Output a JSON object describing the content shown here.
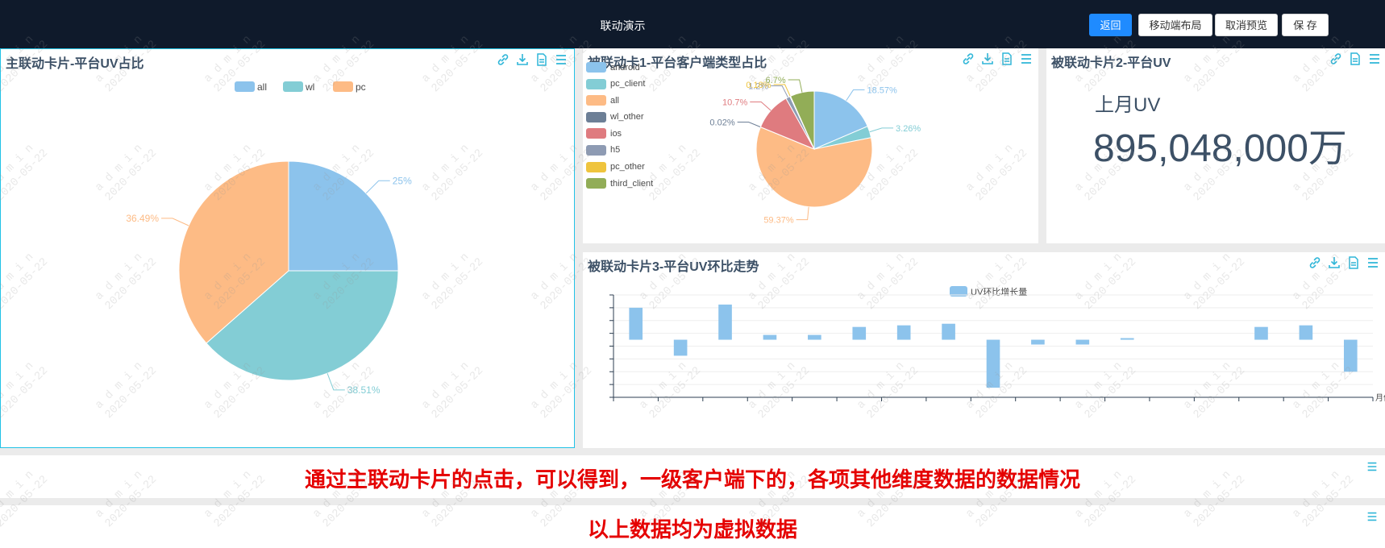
{
  "header": {
    "title": "联动演示",
    "buttons": {
      "back": "返回",
      "mobile_layout": "移动端布局",
      "cancel_preview": "取消预览",
      "save": "保 存"
    }
  },
  "watermark": {
    "user": "admin",
    "date": "2020-05-22"
  },
  "cards": {
    "main": {
      "title": "主联动卡片-平台UV占比"
    },
    "linked1": {
      "title": "被联动卡1-平台客户端类型占比"
    },
    "linked2": {
      "title": "被联动卡片2-平台UV",
      "label": "上月UV",
      "value": "895,048,000万"
    },
    "linked3": {
      "title": "被联动卡片3-平台UV环比走势"
    }
  },
  "banners": {
    "line1": "通过主联动卡片的点击，可以得到，一级客户端下的，各项其他维度数据的数据情况",
    "line2": "以上数据均为虚拟数据"
  },
  "colors": {
    "accent": "#1f8bff",
    "topbar": "#0f1a2b",
    "banner_text": "#e50000"
  },
  "chart_data": [
    {
      "type": "pie",
      "title": "主联动卡片-平台UV占比",
      "legend": [
        "all",
        "wl",
        "pc"
      ],
      "legend_position": "top",
      "slices": [
        {
          "name": "all",
          "value": 25,
          "label": "25%",
          "color": "#8cc3ec"
        },
        {
          "name": "wl",
          "value": 38.51,
          "label": "38.51%",
          "color": "#83cdd5"
        },
        {
          "name": "pc",
          "value": 36.49,
          "label": "36.49%",
          "color": "#fdbb85"
        }
      ]
    },
    {
      "type": "pie",
      "title": "被联动卡1-平台客户端类型占比",
      "legend": [
        "android",
        "pc_client",
        "all",
        "wl_other",
        "ios",
        "h5",
        "pc_other",
        "third_client"
      ],
      "legend_position": "left",
      "slices": [
        {
          "name": "android",
          "value": 18.57,
          "label": "18.57%",
          "color": "#8cc3ec"
        },
        {
          "name": "pc_client",
          "value": 3.26,
          "label": "3.26%",
          "color": "#83cdd5"
        },
        {
          "name": "all",
          "value": 59.37,
          "label": "59.37%",
          "color": "#fdbb85"
        },
        {
          "name": "wl_other",
          "value": 0.02,
          "label": "0.02%",
          "color": "#6d7f96"
        },
        {
          "name": "ios",
          "value": 10.7,
          "label": "10.7%",
          "color": "#df7b7f"
        },
        {
          "name": "h5",
          "value": 1.2,
          "label": "1.2%",
          "color": "#8e9bb3"
        },
        {
          "name": "pc_other",
          "value": 0.18,
          "label": "0.18%",
          "color": "#efc43d"
        },
        {
          "name": "third_client",
          "value": 6.7,
          "label": "6.7%",
          "color": "#92ad57"
        }
      ]
    },
    {
      "type": "bar",
      "title": "被联动卡片3-平台UV环比走势",
      "series": [
        {
          "name": "UV环比增长量",
          "color": "#8cc3ec",
          "values": [
            10,
            -5,
            11,
            1.5,
            1.5,
            4,
            4.5,
            5,
            -15,
            -1.5,
            -1.5,
            0.5,
            0,
            0,
            4,
            4.5,
            -10
          ]
        }
      ],
      "xlabel": "月份",
      "ylim": [
        -18,
        14
      ],
      "y_tick_labels": "not shown",
      "x_tick_labels": "not shown",
      "grid": true,
      "legend_position": "top"
    }
  ]
}
